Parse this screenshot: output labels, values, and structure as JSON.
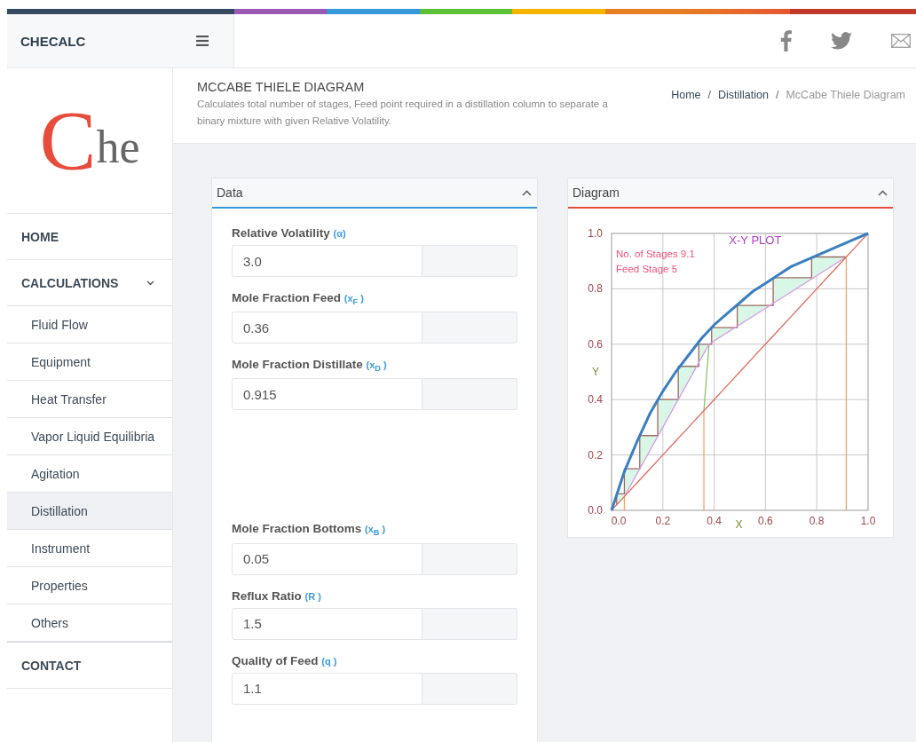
{
  "brand": "CHECALC",
  "logo": {
    "initial": "C",
    "rest": "he"
  },
  "page_header": {
    "title": "MCCABE THIELE DIAGRAM",
    "description": "Calculates total number of stages, Feed point required in a distillation column to separate a binary mixture with given Relative Volatility."
  },
  "breadcrumb": {
    "separator": "/",
    "items": [
      {
        "label": "Home",
        "current": false
      },
      {
        "label": "Distillation",
        "current": false
      },
      {
        "label": "McCabe Thiele Diagram",
        "current": true
      }
    ]
  },
  "sidebar": {
    "items": [
      {
        "label": "HOME",
        "selected": false
      },
      {
        "label": "CALCULATIONS",
        "selected": false,
        "expanded": true,
        "children": [
          {
            "label": "Fluid Flow",
            "selected": false
          },
          {
            "label": "Equipment",
            "selected": false
          },
          {
            "label": "Heat Transfer",
            "selected": false
          },
          {
            "label": "Vapor Liquid Equilibria",
            "selected": false
          },
          {
            "label": "Agitation",
            "selected": false
          },
          {
            "label": "Distillation",
            "selected": true
          },
          {
            "label": "Instrument",
            "selected": false
          },
          {
            "label": "Properties",
            "selected": false
          },
          {
            "label": "Others",
            "selected": false
          }
        ]
      },
      {
        "label": "CONTACT",
        "selected": false
      }
    ]
  },
  "data_panel": {
    "title": "Data",
    "expanded": true,
    "color": "#3498db",
    "fields": [
      {
        "label": "Relative Volatility",
        "symbol": "(α)",
        "value": "3.0"
      },
      {
        "label": "Mole Fraction Feed",
        "symbol": "(x$_{F}$ )",
        "value": "0.36"
      },
      {
        "label": "Mole Fraction Distillate",
        "symbol": "(x$_{D}$ )",
        "value": "0.915"
      },
      {
        "label": "Mole Fraction Bottoms",
        "symbol": "(x$_{B}$ )",
        "value": "0.05"
      },
      {
        "label": "Reflux Ratio",
        "symbol": "(R )",
        "value": "1.5"
      },
      {
        "label": "Quality of Feed",
        "symbol": "(q )",
        "value": "1.1"
      }
    ]
  },
  "diagram_panel": {
    "title": "Diagram",
    "expanded": true,
    "color": "#e74c3c",
    "chart_data": {
      "type": "line",
      "title": "X-Y PLOT",
      "xlabel": "X",
      "ylabel": "Y",
      "x": [
        0,
        0.05,
        0.1,
        0.15,
        0.2,
        0.25,
        0.3,
        0.35,
        0.4,
        0.45,
        0.5,
        0.55,
        0.6,
        0.65,
        0.7,
        0.75,
        0.8,
        0.85,
        0.9,
        0.95,
        1
      ],
      "series": [
        {
          "color": "#3a7fc1",
          "values": [
            0,
            0.14,
            0.25,
            0.35,
            0.43,
            0.5,
            0.56,
            0.62,
            0.67,
            0.71,
            0.75,
            0.79,
            0.82,
            0.85,
            0.88,
            0.9,
            0.92,
            0.94,
            0.96,
            0.98,
            1
          ]
        },
        {
          "color": "#e06b5e",
          "values": [
            0,
            0.05,
            0.1,
            0.15,
            0.2,
            0.25,
            0.3,
            0.35,
            0.4,
            0.45,
            0.5,
            0.55,
            0.6,
            0.65,
            0.7,
            0.75,
            0.8,
            0.85,
            0.9,
            0.95,
            1
          ]
        },
        {
          "color": "#d59be6",
          "x": [
            0.915,
            0.38,
            0.05
          ],
          "values": [
            0.915,
            0.6,
            0.05
          ]
        },
        {
          "color": "#8cc26a",
          "x": [
            0.36,
            0.38
          ],
          "values": [
            0.36,
            0.6
          ]
        },
        {
          "color": "#f5a35c",
          "x": [
            0.05,
            0.05
          ],
          "values": [
            0,
            0.05
          ]
        },
        {
          "color": "#f5a35c",
          "x": [
            0.36,
            0.36
          ],
          "values": [
            0,
            0.36
          ]
        },
        {
          "color": "#f5a35c",
          "x": [
            0.915,
            0.915
          ],
          "values": [
            0,
            0.915
          ]
        },
        {
          "color": "#9a6b60",
          "x": [
            0.915,
            0.78,
            0.78,
            0.63,
            0.63,
            0.49,
            0.49,
            0.39,
            0.39,
            0.34,
            0.34,
            0.26,
            0.26,
            0.18,
            0.18,
            0.11,
            0.11,
            0.05,
            0.05,
            0.02,
            0.02
          ],
          "values": [
            0.915,
            0.915,
            0.84,
            0.84,
            0.74,
            0.74,
            0.66,
            0.66,
            0.6,
            0.6,
            0.52,
            0.52,
            0.4,
            0.4,
            0.27,
            0.27,
            0.15,
            0.15,
            0.06,
            0.06,
            0.02
          ]
        }
      ],
      "grid": true,
      "xlim": [
        0,
        1
      ],
      "ylim": [
        0,
        1
      ],
      "xticks": [
        {
          "value": 0,
          "label": "0.0"
        },
        {
          "value": 0.2,
          "label": "0.2"
        },
        {
          "value": 0.4,
          "label": "0.4"
        },
        {
          "value": 0.6,
          "label": "0.6"
        },
        {
          "value": 0.8,
          "label": "0.8"
        },
        {
          "value": 1,
          "label": "1.0"
        }
      ],
      "yticks": [
        {
          "value": 0,
          "label": "0.0"
        },
        {
          "value": 0.2,
          "label": "0.2"
        },
        {
          "value": 0.4,
          "label": "0.4"
        },
        {
          "value": 0.6,
          "label": "0.6"
        },
        {
          "value": 0.8,
          "label": "0.8"
        },
        {
          "value": 1,
          "label": "1.0"
        }
      ],
      "annotations": [
        "No. of Stages 9.1",
        "Feed Stage 5"
      ]
    }
  }
}
